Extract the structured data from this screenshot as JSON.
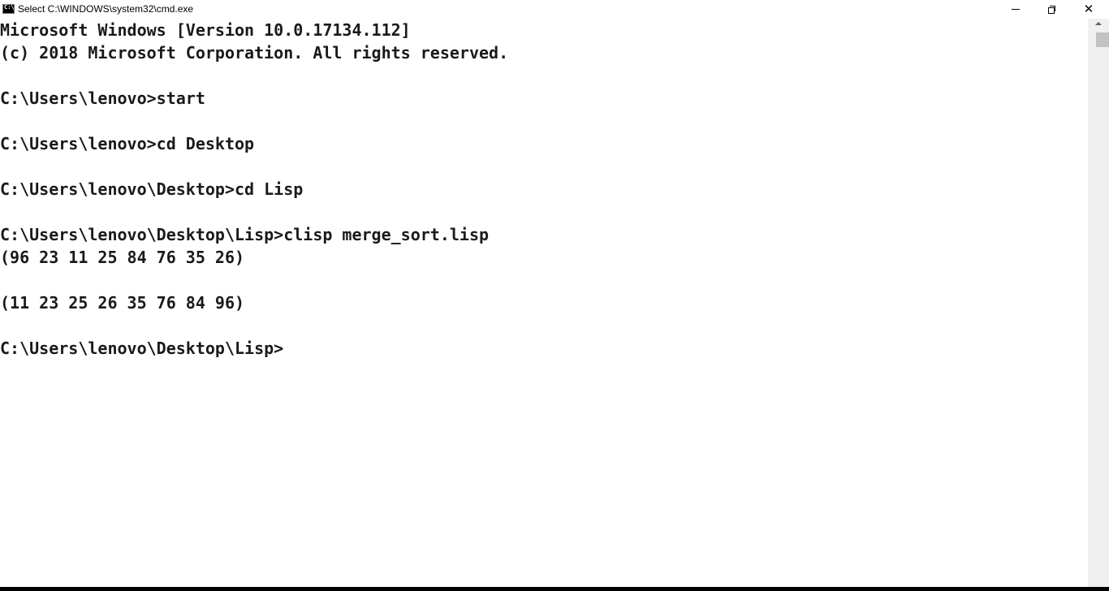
{
  "window": {
    "title": "Select C:\\WINDOWS\\system32\\cmd.exe",
    "icon": "cmd-icon",
    "controls": {
      "minimize_icon": "minimize-icon",
      "restore_icon": "restore-icon",
      "close_glyph": "✕"
    }
  },
  "console": {
    "lines": [
      "Microsoft Windows [Version 10.0.17134.112]",
      "(c) 2018 Microsoft Corporation. All rights reserved.",
      "",
      "C:\\Users\\lenovo>start",
      "",
      "C:\\Users\\lenovo>cd Desktop",
      "",
      "C:\\Users\\lenovo\\Desktop>cd Lisp",
      "",
      "C:\\Users\\lenovo\\Desktop\\Lisp>clisp merge_sort.lisp",
      "(96 23 11 25 84 76 35 26)",
      "",
      "(11 23 25 26 35 76 84 96)",
      "",
      "C:\\Users\\lenovo\\Desktop\\Lisp>"
    ]
  },
  "colors": {
    "background": "#ffffff",
    "text": "#1a1a1a",
    "scrollbar_track": "#f0f0f0",
    "scrollbar_thumb": "#c2c2c2"
  }
}
